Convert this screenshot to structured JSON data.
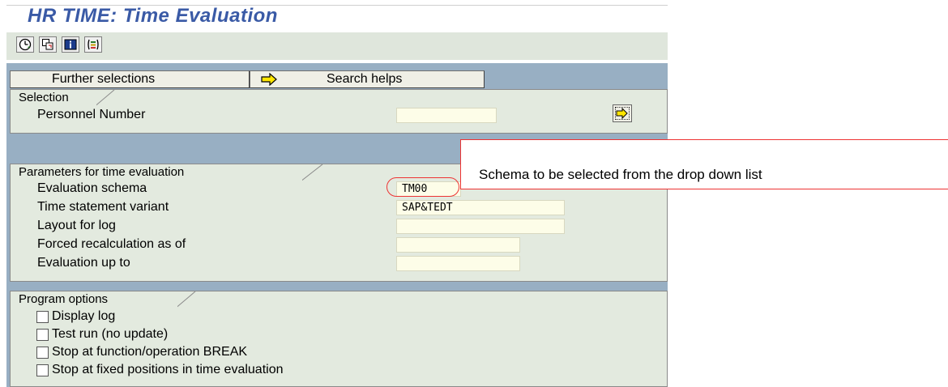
{
  "title": "HR TIME: Time Evaluation",
  "toolbar": {
    "icons": [
      "execute-icon",
      "copy-variant-icon",
      "information-icon",
      "selection-options-icon"
    ]
  },
  "top_buttons": {
    "further_selections": "Further selections",
    "search_helps": "Search helps"
  },
  "selection": {
    "tab": "Selection",
    "personnel_number_label": "Personnel Number",
    "personnel_number_value": ""
  },
  "parameters": {
    "tab": "Parameters for time evaluation",
    "rows": [
      {
        "label": "Evaluation schema",
        "value": "TM00"
      },
      {
        "label": "Time statement variant",
        "value": "SAP&TEDT"
      },
      {
        "label": "Layout for log",
        "value": ""
      },
      {
        "label": "Forced recalculation as of",
        "value": ""
      },
      {
        "label": "Evaluation up to",
        "value": ""
      }
    ]
  },
  "program_options": {
    "tab": "Program options",
    "options": [
      {
        "label": "Display log",
        "checked": false
      },
      {
        "label": "Test run (no update)",
        "checked": false
      },
      {
        "label": "Stop at function/operation BREAK",
        "checked": false
      },
      {
        "label": "Stop at fixed positions in time evaluation",
        "checked": false
      }
    ]
  },
  "annotation": {
    "text": "Schema to be selected from the drop down list",
    "color": "#e33333"
  },
  "colors": {
    "title": "#3a5aa6",
    "app_background": "#98afc3",
    "group_background": "#e3eadf",
    "field_background": "#fdfde8"
  }
}
